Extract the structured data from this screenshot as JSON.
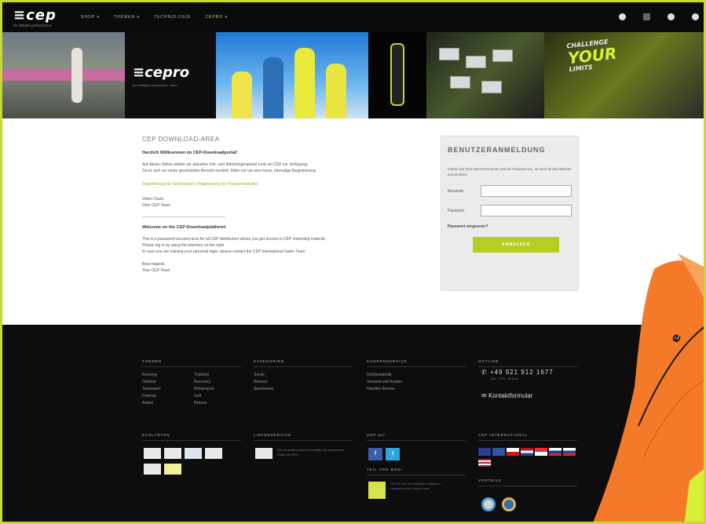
{
  "header": {
    "logo": "≡cep",
    "logo_tag": "for athletic performance",
    "nav": [
      "SHOP ▾",
      "THEMEN ▾",
      "TECHNOLOGIE",
      "CEPRO ▾"
    ],
    "icons": [
      "globe-icon",
      "bag-icon",
      "user-icon",
      "settings-icon"
    ]
  },
  "banner": {
    "cepro": "≡cepro",
    "cepro_tag": "the intelligent sportswear · team",
    "challenge": "CHALLENGE",
    "your": "YOUR",
    "limits": "LIMITS"
  },
  "main": {
    "title": "CEP DOWNLOAD-AREA",
    "welcome_de": "Herzlich Willkommen im CEP-Downloadportal!",
    "text_de_1": "Auf diesen Seiten stellen wir aktuelles Info- und Marketingmaterial rund um CEP zur Verfügung.",
    "text_de_2": "Da es sich um einen geschützten Bereich handelt, bitten wir um eine kurze, einmalige Registrierung.",
    "link_1": "Registrierung für Fachhändler",
    "link_sep": " | ",
    "link_2": "Registrierung für Pressemitarbeiter",
    "thanks_1": "Vielen Dank,",
    "thanks_2": "Dein CEP-Team",
    "welcome_en": "Welcome on the CEP-Downloadplatform!",
    "text_en_1": "This is a password-secured area for all CEP distributors where you get access to CEP marketing material.",
    "text_en_2": "Please log in by using the interface on the right.",
    "text_en_3": "In case you are missing your personal login, please contact the CEP International Sales Team.",
    "regards_1": "Best regards,",
    "regards_2": "Your CEP-Team"
  },
  "login": {
    "title": "BENUTZERANMELDUNG",
    "intro": "Geben Sie Ihren Benutzernamen und Ihr Passwort ein, um sich an der Website anzumelden:",
    "user_label": "Benutzer:",
    "user_value": "",
    "pass_label": "Passwort:",
    "pass_value": "",
    "forgot": "Passwort vergessen?",
    "button": "ANMELDEN"
  },
  "footer": {
    "themen_title": "THEMEN",
    "themen_col1": [
      "Running",
      "Outdoor",
      "Teamsport",
      "Fahrrad",
      "Reiten"
    ],
    "themen_col2": [
      "Triathlon",
      "Recovery",
      "Wintersport",
      "Golf",
      "Fitness"
    ],
    "kategorien_title": "KATEGORIEN",
    "kategorien": [
      "Socks",
      "Sleeves",
      "Sportswear"
    ],
    "kundenservice_title": "KUNDENSERVICE",
    "kundenservice": [
      "Größentabelle",
      "Versand und Kosten",
      "Händler-Service"
    ],
    "hotline_title": "HOTLINE",
    "hotline": "+49 921 912 1677",
    "hotline_sub": "(Mo - Fr 9 - 18 Uhr)",
    "kontakt": "Kontaktformular",
    "zahlarten_title": "ZAHLARTEN",
    "lieferservice_title": "LIEFERSERVICE",
    "liefer_text": "Wir versenden unsere Produkte als versichertes Paket mit DPD",
    "cep_auf_title": "CEP auf",
    "social": [
      "f",
      "t"
    ],
    "teil_title": "TEIL VON MEDI",
    "teil_text": "CEP ist Teil der deutschen Hightech Konzerns medi. Learn more",
    "international_title": "CEP INTERNATIONAL",
    "vorteile_title": "VORTEILE"
  },
  "colors": {
    "accent": "#b8cd23",
    "frame": "#c9d92b",
    "sock": "#f47a2a"
  }
}
